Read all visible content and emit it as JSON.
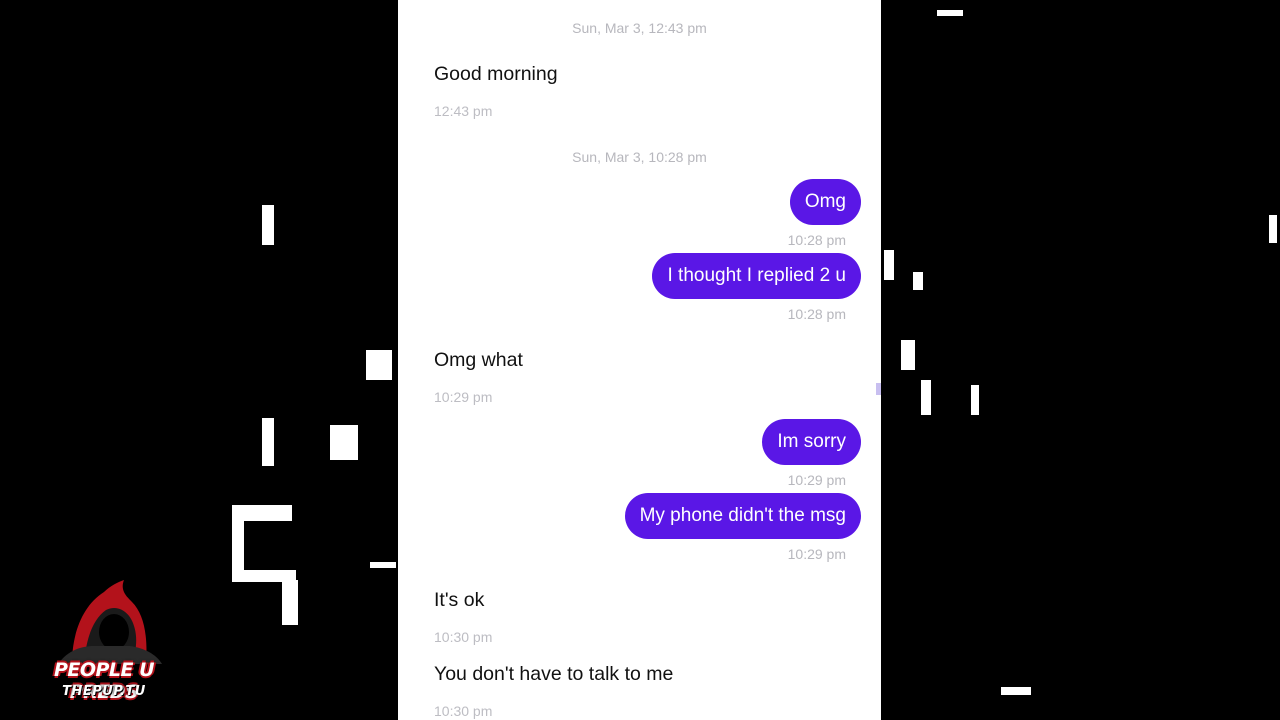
{
  "conversation": {
    "date_dividers": [
      "Sun, Mar 3, 12:43 pm",
      "Sun, Mar 3, 10:28 pm"
    ],
    "messages": [
      {
        "direction": "incoming",
        "text": "Good morning",
        "time": "12:43 pm"
      },
      {
        "direction": "outgoing",
        "text": "Omg",
        "time": "10:28 pm"
      },
      {
        "direction": "outgoing",
        "text": "I thought I replied 2 u",
        "time": "10:28 pm"
      },
      {
        "direction": "incoming",
        "text": "Omg what",
        "time": "10:29 pm"
      },
      {
        "direction": "outgoing",
        "text": "Im sorry",
        "time": "10:29 pm"
      },
      {
        "direction": "outgoing",
        "text": "My phone didn't the msg",
        "time": "10:29 pm"
      },
      {
        "direction": "incoming",
        "text": "It's ok",
        "time": "10:30 pm"
      },
      {
        "direction": "incoming",
        "text": "You don't have to talk to me",
        "time": "10:30 pm"
      }
    ]
  },
  "watermark": {
    "title": "PEOPLE U PREDS",
    "subtitle": "THEPUP.TU"
  },
  "colors": {
    "outgoing_bubble": "#5a17e6",
    "background": "#000000",
    "phone_background": "#ffffff",
    "timestamp": "#b7b7bd"
  }
}
